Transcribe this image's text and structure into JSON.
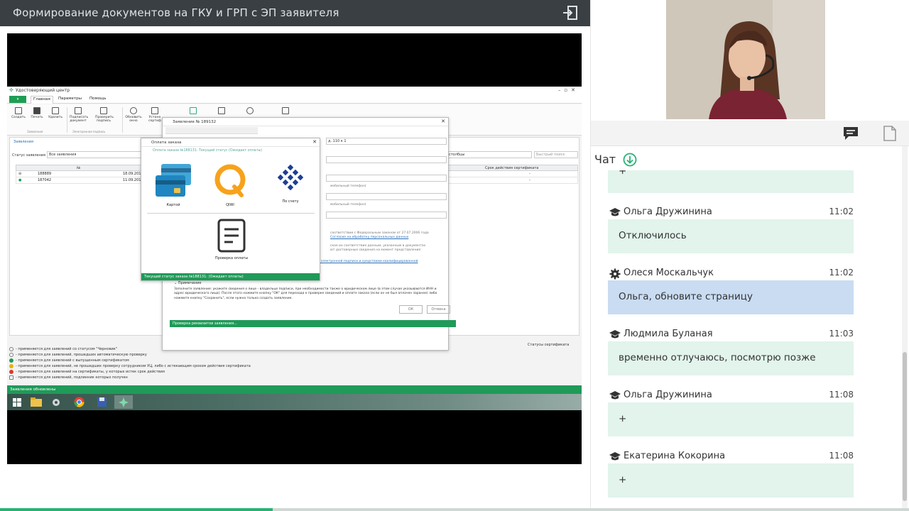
{
  "header": {
    "title": "Формирование документов на ГКУ и ГРП с ЭП заявителя"
  },
  "app": {
    "window_title": "Удостоверяющий центр",
    "tabs": [
      "Главная",
      "Параметры",
      "Помощь"
    ],
    "ribbon": {
      "create": "Создать",
      "print": "Печать",
      "delete": "Удалить",
      "sign_doc": "Подписать документ",
      "check_sign": "Проверить подпись",
      "refresh": "Обновить окно",
      "install_cert": "Устано сертиф",
      "group_requests": "Заявления",
      "group_signature": "Электронная подпись"
    },
    "breadcrumb": "Заявления",
    "filter_label": "Статус заявления",
    "filter_value": "Все заявления",
    "columns_btn": "столбцы",
    "search_placeholder": "Быстрый поиск",
    "grid": {
      "col_number": "№",
      "col_cert_term": "Срок действия сертификата",
      "rows": [
        {
          "number": "188889",
          "date": "18.09.2018",
          "term": "-"
        },
        {
          "number": "187042",
          "date": "11.09.2018",
          "term": "-"
        }
      ]
    },
    "cert_status_link": "Статусы сертификата",
    "legend": [
      "- применяется для заявлений со статусом \"Черновик\"",
      "- применяется для заявлений, прошедших автоматическую проверку",
      "- применяется для заявлений с выпущенным сертификатом",
      "- применяется для заявлений, не прошедших проверку сотрудником УЦ, либо с истекающим сроком действия сертификата",
      "- применяется для заявлений на сертификаты, у которых истек срок действия",
      "- применяется для заявлений, подлинник которых получен"
    ],
    "status_strip": "Заявления обновлены"
  },
  "request_dialog": {
    "title": "Заявление № 189132",
    "field_hint_1": "д. 110 к 1",
    "phone_hint_1": "мобильный телефон)",
    "phone_hint_2": "мобильный телефон)",
    "consent_text": "соответствии с Федеральным законом от 27.07.2006 года",
    "consent_link": "Согласие на обработку персональных данных",
    "doc_text_1": "ское их соответствие данным, указанным в документах",
    "doc_text_2": "ют достоверные сведения на момент представления",
    "checkbox_text": "С руководством по обеспечению безопасности использования квалифицированной электронной подписи и средствами квалифицированной электронной подписи ознакомлен(а)",
    "note_title": "Примечание",
    "note_text": "Заполните заявление: укажите сведения о лице - владельце подписи, при необходимости также о юридическом лице (в этом случае указываются ИНН и адрес юридического лица). После этого нажмите кнопку \"ОК\" для перехода к проверке сведений и оплате заказа (если он не был оплачен заранее) либо нажмите кнопку \"Сохранить\", если нужно только создать заявление.",
    "ok_label": "ОК",
    "cancel_label": "Отмена",
    "status_bar": "Проверка реквизитов заявления..."
  },
  "payment_dialog": {
    "title": "Оплата заказа",
    "order_status": "Оплата заказа №188131: Текущий статус (Ожидает оплаты)",
    "card": "Картой",
    "qiwi": "QIWI",
    "invoice": "По счету",
    "check_payment": "Проверка оплаты",
    "status_bar": "Текущий статус заказа №188131: (Ожидает оплаты)"
  },
  "chat": {
    "title": "Чат",
    "messages": [
      {
        "author": "",
        "time": "",
        "text": "+",
        "role": "student"
      },
      {
        "author": "Ольга Дружинина",
        "time": "11:02",
        "text": "Отключилось",
        "role": "student"
      },
      {
        "author": "Олеся Москальчук",
        "time": "11:02",
        "text": "Ольга, обновите страницу",
        "role": "moderator"
      },
      {
        "author": "Людмила Буланая",
        "time": "11:03",
        "text": "временно отлучаюсь, посмотрю позже",
        "role": "student"
      },
      {
        "author": "Ольга Дружинина",
        "time": "11:08",
        "text": "+",
        "role": "student"
      },
      {
        "author": "Екатерина Кокорина",
        "time": "11:08",
        "text": "+",
        "role": "student"
      }
    ]
  },
  "colors": {
    "accent_green": "#27b374",
    "app_green": "#1f9a58",
    "bubble": "#e2f4ec",
    "bubble_moderator": "#c9dcf2",
    "topbar": "#3a3f44"
  },
  "playback": {
    "progress_fraction": 0.3
  }
}
